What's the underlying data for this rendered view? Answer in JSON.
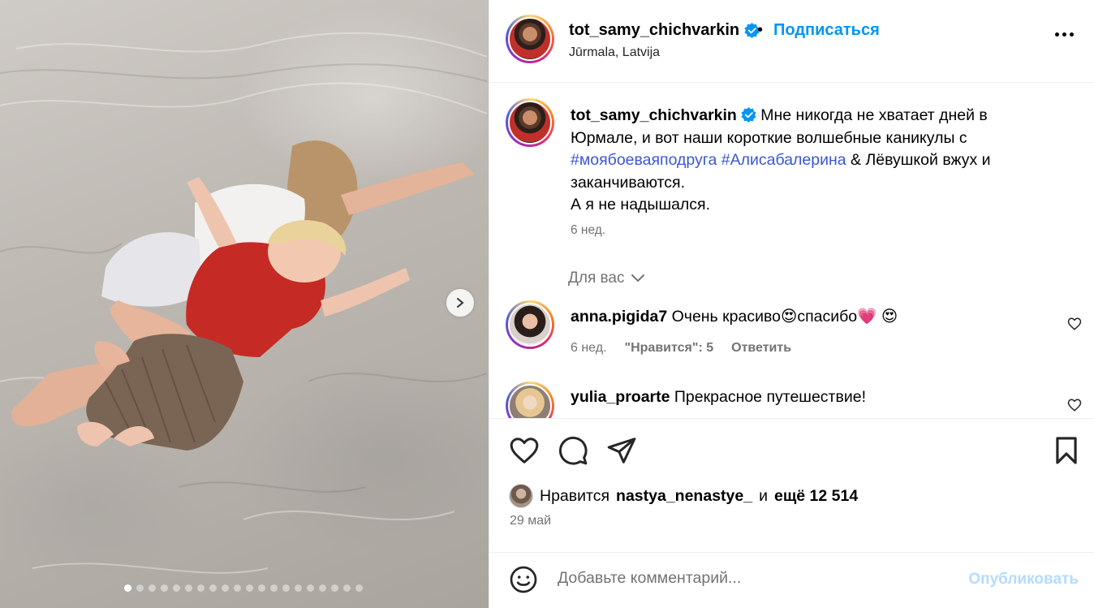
{
  "post": {
    "username": "tot_samy_chichvarkin",
    "separator": "•",
    "follow_label": "Подписаться",
    "location": "Jūrmala, Latvija",
    "more_icon": "more-horizontal-icon",
    "verified_color": "#0095f6"
  },
  "caption": {
    "username": "tot_samy_chichvarkin",
    "text_part1": " Мне никогда не хватает дней в Юрмале, и вот наши короткие волшебные каникулы с ",
    "hashtag1": "#моябоеваяподруга",
    "space": " ",
    "hashtag2": "#Алисабалерина",
    "text_part2": " & Лёвушкой вжух и заканчиваются.",
    "line2": "А я не надышался.",
    "time": "6 нед."
  },
  "for_you": {
    "label": "Для вас"
  },
  "comments": [
    {
      "username": "anna.pigida7",
      "text": " Очень красиво😍спасибо💗 😍",
      "time": "6 нед.",
      "likes": "\"Нравится\": 5",
      "reply": "Ответить"
    },
    {
      "username": "yulia_proarte",
      "text": " Прекрасное путешествие!"
    }
  ],
  "engagement": {
    "likes_prefix": "Нравится",
    "liker": "nastya_nenastye_",
    "and": "и",
    "others": "ещё 12 514",
    "date": "29 май"
  },
  "composer": {
    "placeholder": "Добавьте комментарий...",
    "publish_label": "Опубликовать"
  },
  "carousel": {
    "total_slides": 20,
    "current_index": 0
  }
}
